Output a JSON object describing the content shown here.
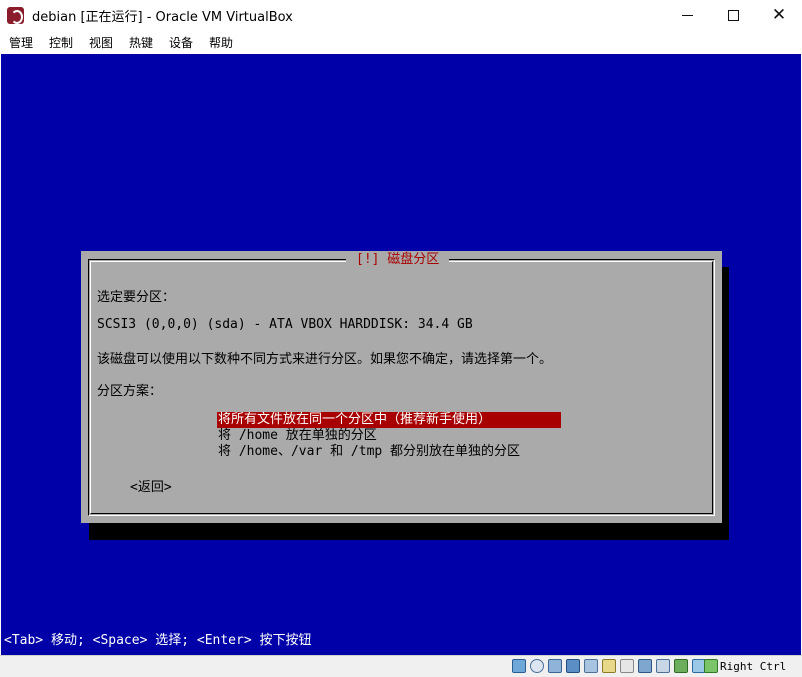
{
  "window": {
    "title": "debian [正在运行] - Oracle VM VirtualBox",
    "minimize": "—",
    "maximize": "☐",
    "close": "✕"
  },
  "menu": [
    "管理",
    "控制",
    "视图",
    "热键",
    "设备",
    "帮助"
  ],
  "dialog": {
    "title": "[!] 磁盘分区",
    "prompt": "选定要分区：",
    "disk": "SCSI3 (0,0,0) (sda) - ATA VBOX HARDDISK: 34.4 GB",
    "description": "该磁盘可以使用以下数种不同方式来进行分区。如果您不确定，请选择第一个。",
    "scheme_label": "分区方案：",
    "options": [
      "将所有文件放在同一个分区中（推荐新手使用）",
      "将 /home 放在单独的分区",
      "将 /home、/var 和 /tmp 都分别放在单独的分区"
    ],
    "selected_index": 0,
    "back_button": "<返回>"
  },
  "hint": "<Tab> 移动; <Space> 选择; <Enter> 按下按钮",
  "statusbar": {
    "host_key": "Right Ctrl",
    "icons": [
      "hard-disk-icon",
      "optical-drive-icon",
      "audio-icon",
      "network-icon",
      "usb-icon",
      "shared-folder-icon",
      "display-icon",
      "recording-icon",
      "drag-drop-icon",
      "cpu-icon",
      "mouse-integration-icon",
      "keyboard-icon"
    ]
  },
  "colors": {
    "vm_background": "#0000a8",
    "dialog_background": "#aaaaaa",
    "selection": "#a80000",
    "title_text": "#a80000"
  }
}
